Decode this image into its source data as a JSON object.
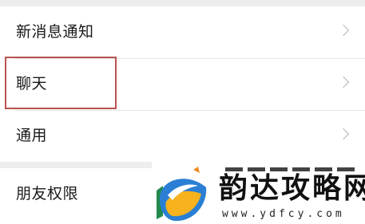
{
  "settings": {
    "group1": [
      {
        "label": "新消息通知"
      },
      {
        "label": "聊天"
      },
      {
        "label": "通用"
      }
    ],
    "group2": [
      {
        "label": "朋友权限"
      }
    ]
  },
  "watermark": {
    "title": "韵达攻略网",
    "url": "www.ydfcy.com"
  },
  "colors": {
    "background": "#ededed",
    "highlight": "#b9534f",
    "logo_blue": "#2a7fd4",
    "logo_yellow": "#f7b21d"
  }
}
